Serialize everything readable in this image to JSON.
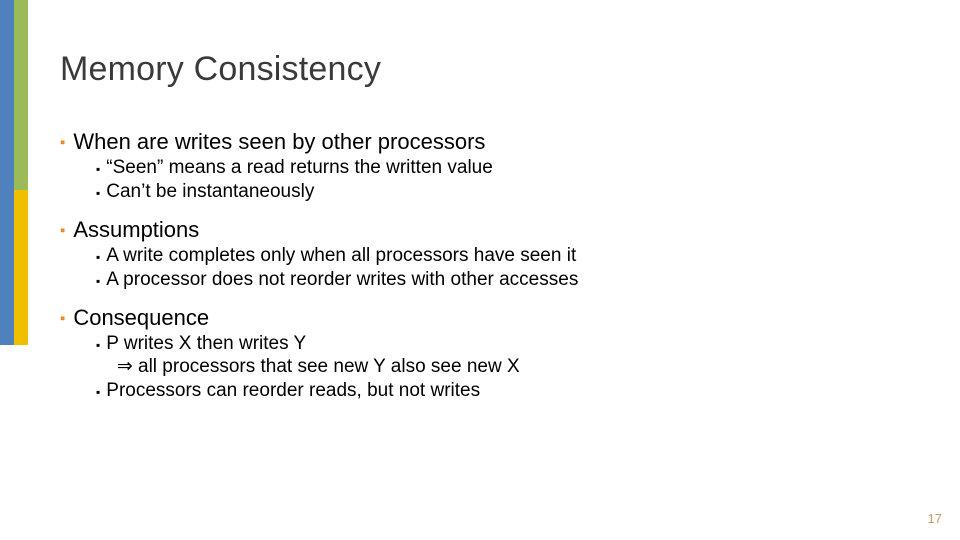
{
  "title": "Memory Consistency",
  "accent": {
    "orange": "#e38b27",
    "blue": "#4f81bd",
    "green": "#9bbb59",
    "yellow": "#f0c000"
  },
  "bullets": {
    "p1": "When are writes seen by other processors",
    "p1a": "“Seen” means a read returns the written value",
    "p1b": "Can’t be instantaneously",
    "p2": "Assumptions",
    "p2a": "A write completes only when all processors have seen it",
    "p2b": "A processor does not reorder writes with other accesses",
    "p3": "Consequence",
    "p3a": "P writes X then writes Y ⇒ all processors that see new Y also see new X",
    "p3b": "Processors can reorder reads, but not writes"
  },
  "page_number": "17"
}
